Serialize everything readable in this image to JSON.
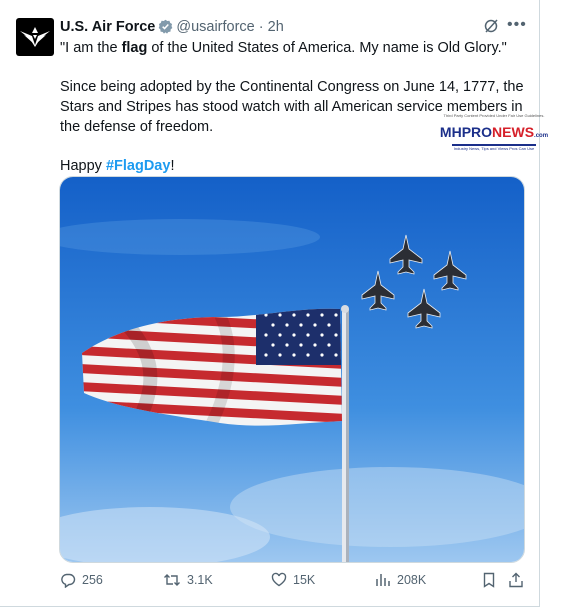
{
  "author": {
    "name": "U.S. Air Force",
    "handle": "@usairforce",
    "separator": "·",
    "time": "2h",
    "verified": true,
    "avatar_icon": "air-force-wings-icon"
  },
  "tweet": {
    "line1_pre": "\"I am the ",
    "line1_bold": "flag",
    "line1_post": " of the United States of America. My name is Old Glory.\"",
    "paragraph2": "Since being adopted by the Continental Congress on June 14, 1777, the Stars and Stripes has stood watch with all American service members in the defense of freedom.",
    "happy": "Happy ",
    "hashtag": "#FlagDay",
    "exclaim": "!"
  },
  "watermark": {
    "top_text": "Third Party Content Provided Under Fair Use Guidelines.",
    "mh": "MH",
    "pro": "PRO",
    "news": "NEWS",
    "dotcom": ".com",
    "bottom_text": "Industry News, Tips and Views Pros Can Use"
  },
  "media": {
    "description_icon": "flag-and-jets-photo"
  },
  "actions": {
    "replies": "256",
    "reposts": "3.1K",
    "likes": "15K",
    "views": "208K"
  },
  "colors": {
    "accent": "#1d9bf0",
    "secondary_text": "#536471",
    "primary_text": "#0f1419"
  }
}
